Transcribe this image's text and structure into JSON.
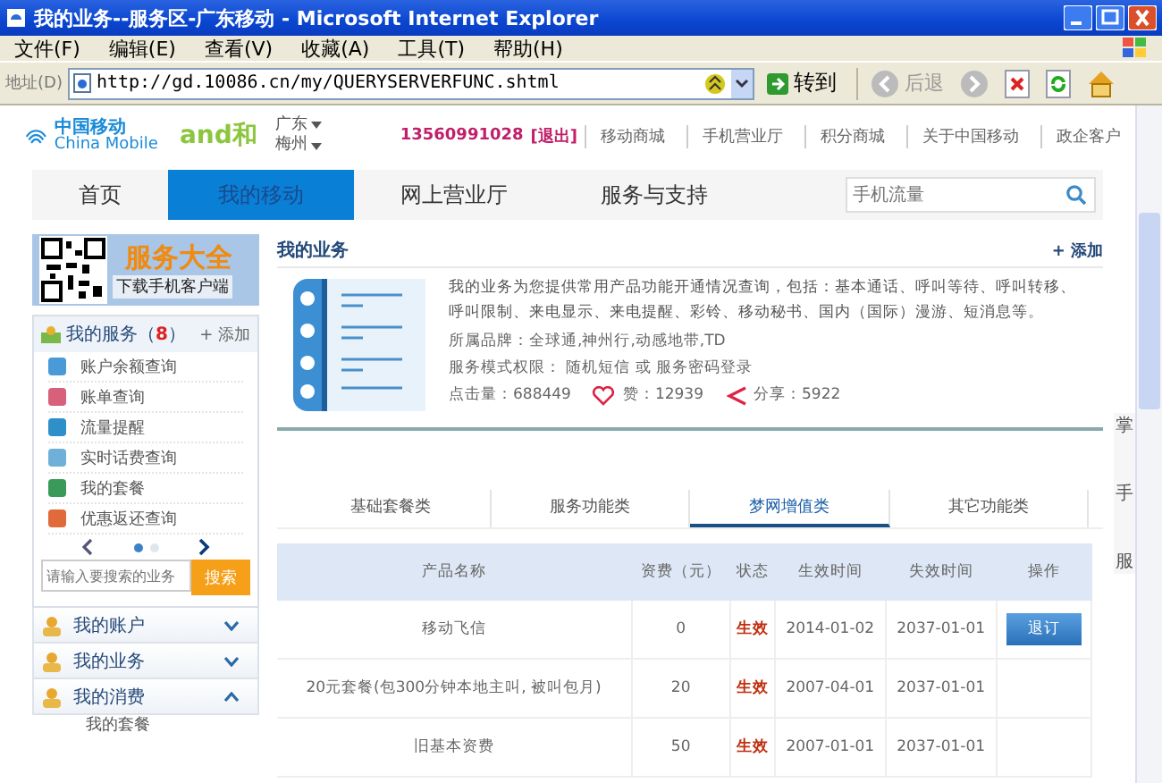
{
  "window": {
    "title": "我的业务--服务区-广东移动 - Microsoft Internet Explorer"
  },
  "menu": [
    "文件(F)",
    "编辑(E)",
    "查看(V)",
    "收藏(A)",
    "工具(T)",
    "帮助(H)"
  ],
  "address_bar": {
    "label": "地址(D)",
    "url": "http://gd.10086.cn/my/QUERYSERVERFUNC.shtml",
    "go": "转到",
    "back": "后退"
  },
  "header": {
    "logo_cn": "中国移动",
    "logo_en": "China Mobile",
    "brand": "and和",
    "regions": [
      "广东",
      "梅州"
    ],
    "phone": "13560991028",
    "logout": "[退出]",
    "links": [
      "移动商城",
      "手机营业厅",
      "积分商城",
      "关于中国移动",
      "政企客户"
    ]
  },
  "nav": {
    "items": [
      {
        "label": "首页",
        "selected": false
      },
      {
        "label": "我的移动",
        "selected": true
      },
      {
        "label": "网上营业厅",
        "selected": false
      },
      {
        "label": "服务与支持",
        "selected": false
      }
    ],
    "search_placeholder": "手机流量"
  },
  "sidebar": {
    "banner": {
      "title": "服务大全",
      "subtitle": "下载手机客户端"
    },
    "services": {
      "title": "我的服务（",
      "count": "8",
      "title_end": "）",
      "add": "+ 添加",
      "items": [
        {
          "label": "账户余额查询",
          "color": "#4a9ad8"
        },
        {
          "label": "账单查询",
          "color": "#d8607a"
        },
        {
          "label": "流量提醒",
          "color": "#2f8fc8"
        },
        {
          "label": "实时话费查询",
          "color": "#6fb0d8"
        },
        {
          "label": "我的套餐",
          "color": "#3a9a5a"
        },
        {
          "label": "优惠返还查询",
          "color": "#e06a3a"
        }
      ],
      "pages": [
        {
          "selected": true
        },
        {
          "selected": false
        }
      ],
      "search_placeholder": "请输入要搜索的业务",
      "search_button": "搜索"
    },
    "sections": [
      {
        "label": "我的账户",
        "expanded": false
      },
      {
        "label": "我的业务",
        "expanded": false
      },
      {
        "label": "我的消费",
        "expanded": true,
        "children": [
          "我的套餐"
        ]
      }
    ]
  },
  "main": {
    "title": "我的业务",
    "add": "+ 添加",
    "description": "我的业务为您提供常用产品功能开通情况查询，包括：基本通话、呼叫等待、呼叫转移、呼叫限制、来电显示、来电提醒、彩铃、移动秘书、国内（国际）漫游、短消息等。",
    "brand": "所属品牌：全球通,神州行,动感地带,TD",
    "auth": "服务模式权限： 随机短信 或 服务密码登录",
    "clicks": "点击量：688449",
    "likes": "赞：12939",
    "shares": "分享：5922",
    "tabs": [
      {
        "label": "基础套餐类",
        "selected": false
      },
      {
        "label": "服务功能类",
        "selected": false
      },
      {
        "label": "梦网增值类",
        "selected": true
      },
      {
        "label": "其它功能类",
        "selected": false
      }
    ],
    "table": {
      "columns": [
        "产品名称",
        "资费（元）",
        "状态",
        "生效时间",
        "失效时间",
        "操作"
      ],
      "rows": [
        {
          "name": "移动飞信",
          "fee": "0",
          "status": "生效",
          "start": "2014-01-02",
          "end": "2037-01-01",
          "action": "退订"
        },
        {
          "name": "20元套餐(包300分钟本地主叫, 被叫包月)",
          "fee": "20",
          "status": "生效",
          "start": "2007-04-01",
          "end": "2037-01-01"
        },
        {
          "name": "旧基本资费",
          "fee": "50",
          "status": "生效",
          "start": "2007-01-01",
          "end": "2037-01-01"
        }
      ]
    }
  },
  "side_float": [
    "掌",
    "手",
    "服"
  ]
}
